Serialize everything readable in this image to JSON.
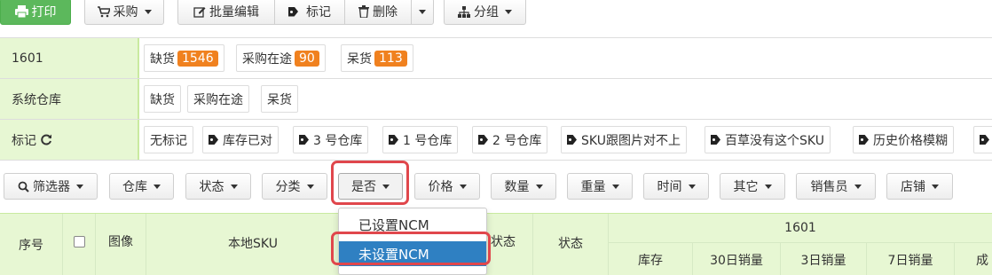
{
  "toolbar": {
    "print": "打印",
    "purchase": "采购",
    "batch_edit": "批量编辑",
    "mark": "标记",
    "delete": "删除",
    "group": "分组"
  },
  "filters": {
    "warehouse_row": {
      "label": "1601",
      "chips": [
        {
          "label": "缺货",
          "count": "1546"
        },
        {
          "label": "采购在途",
          "count": "90"
        },
        {
          "label": "呆货",
          "count": "113"
        }
      ]
    },
    "system_row": {
      "label": "系统仓库",
      "chips": [
        "缺货",
        "采购在途",
        "呆货"
      ]
    },
    "mark_row": {
      "label": "标记",
      "chips": [
        "无标记",
        "库存已对",
        "3 号仓库",
        "1 号仓库",
        "2 号仓库",
        "SKU跟图片对不上",
        "百草没有这个SKU",
        "历史价格模糊"
      ]
    }
  },
  "filterbar": {
    "filter": "筛选器",
    "warehouse": "仓库",
    "status": "状态",
    "category": "分类",
    "yesno": "是否",
    "price": "价格",
    "quantity": "数量",
    "weight": "重量",
    "time": "时间",
    "other": "其它",
    "salesperson": "销售员",
    "shop": "店铺"
  },
  "dropdown": {
    "items": [
      "已设置NCM",
      "未设置NCM"
    ],
    "selected_index": 1
  },
  "table": {
    "col_index": "序号",
    "col_image": "图像",
    "col_sku": "本地SKU",
    "col_status_a": "状态",
    "col_status_b": "状态",
    "group": "1601",
    "sub_stock": "库存",
    "sub_30d": "30日销量",
    "sub_3d": "3日销量",
    "sub_7d": "7日销量",
    "sub_cut": "成"
  },
  "colors": {
    "accent_green": "#5cb85c",
    "badge_orange": "#f0811f",
    "label_bg": "#e7f7d3",
    "highlight_red": "#e0474c",
    "selected_blue": "#2f80c2"
  }
}
